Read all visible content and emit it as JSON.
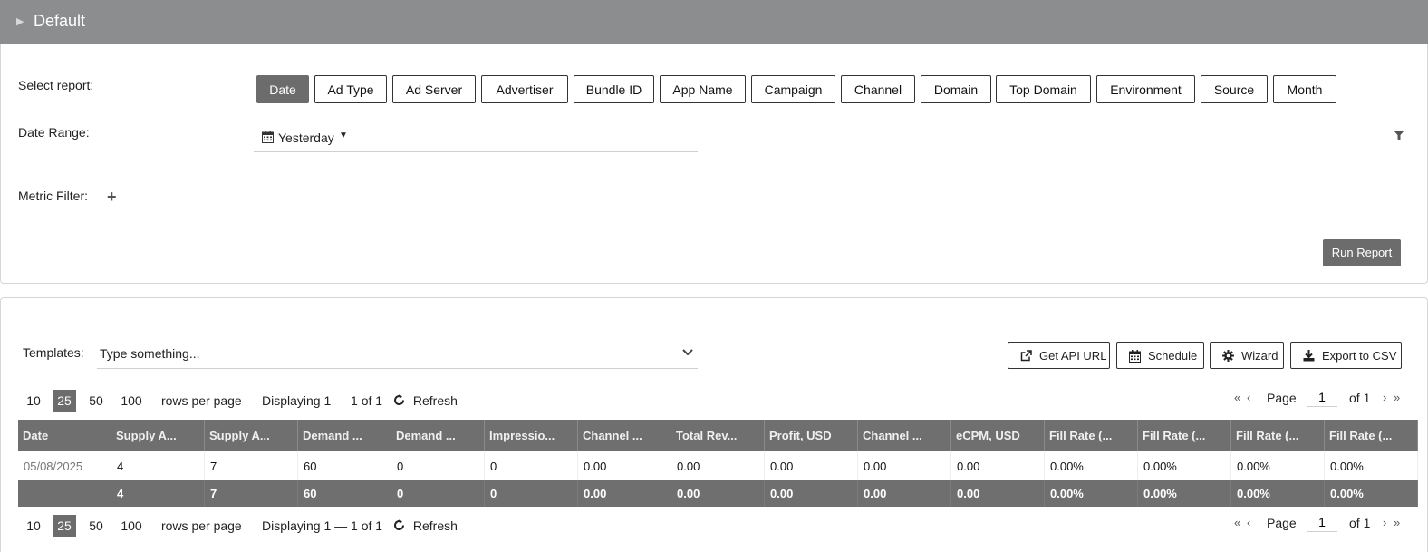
{
  "header": {
    "title": "Default"
  },
  "form": {
    "select_report_label": "Select report:",
    "date_range_label": "Date Range:",
    "metric_filter_label": "Metric Filter:",
    "report_types": [
      "Date",
      "Ad Type",
      "Ad Server",
      "Advertiser",
      "Bundle ID",
      "App Name",
      "Campaign",
      "Channel",
      "Domain",
      "Top Domain",
      "Environment",
      "Source",
      "Month"
    ],
    "active_report": "Date",
    "date_range_value": "Yesterday",
    "run_report_label": "Run Report"
  },
  "templates": {
    "label": "Templates:",
    "placeholder": "Type something..."
  },
  "actions": {
    "api_url": "Get API URL",
    "schedule": "Schedule",
    "wizard": "Wizard",
    "export": "Export to CSV"
  },
  "pagination": {
    "options": [
      "10",
      "25",
      "50",
      "100"
    ],
    "selected": "25",
    "rows_per_page": "rows per page",
    "displaying": "Displaying 1 — 1 of 1",
    "refresh": "Refresh",
    "page_label": "Page",
    "page_value": "1",
    "of_label": "of 1"
  },
  "table": {
    "columns": [
      "Date",
      "Supply A...",
      "Supply A...",
      "Demand ...",
      "Demand ...",
      "Impressio...",
      "Channel ...",
      "Total Rev...",
      "Profit, USD",
      "Channel ...",
      "eCPM, USD",
      "Fill Rate (...",
      "Fill Rate (...",
      "Fill Rate (...",
      "Fill Rate (..."
    ],
    "rows": [
      [
        "05/08/2025",
        "4",
        "7",
        "60",
        "0",
        "0",
        "0.00",
        "0.00",
        "0.00",
        "0.00",
        "0.00",
        "0.00%",
        "0.00%",
        "0.00%",
        "0.00%"
      ]
    ],
    "totals": [
      "",
      "4",
      "7",
      "60",
      "0",
      "0",
      "0.00",
      "0.00",
      "0.00",
      "0.00",
      "0.00",
      "0.00%",
      "0.00%",
      "0.00%",
      "0.00%"
    ]
  }
}
